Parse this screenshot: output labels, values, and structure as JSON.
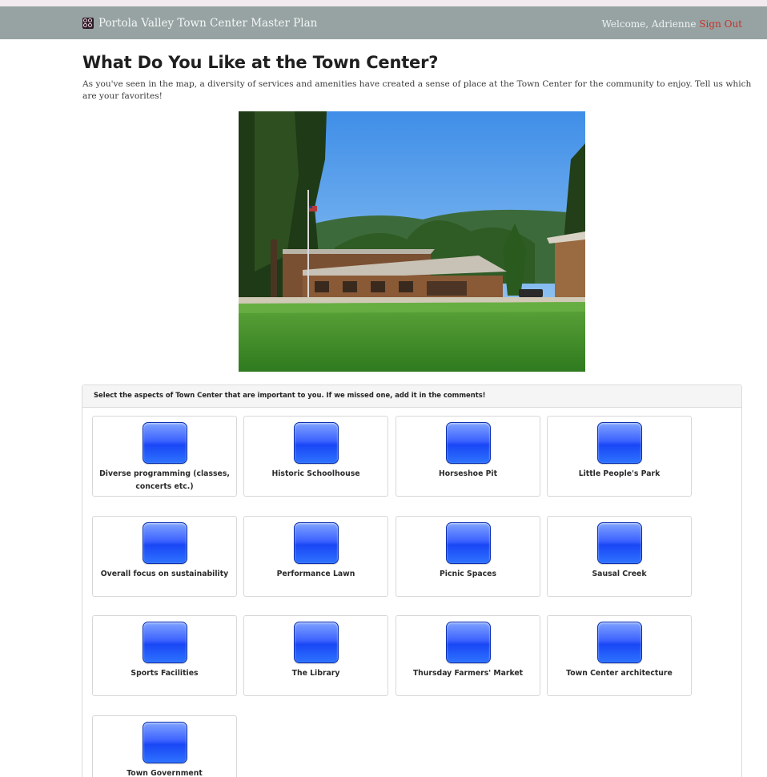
{
  "navbar": {
    "brand": "Portola Valley Town Center Master Plan",
    "welcome": "Welcome, Adrienne",
    "signout": "Sign Out"
  },
  "page": {
    "title": "What Do You Like at the Town Center?",
    "intro": "As you've seen in the map, a diversity of services and amenities have created a sense of place at the Town Center for the community to enjoy. Tell us which are your favorites!"
  },
  "panel": {
    "heading": "Select the aspects of Town Center that are important to you. If we missed one, add it in the comments!",
    "options": [
      {
        "label": "Diverse programming (classes, concerts etc.)"
      },
      {
        "label": "Historic Schoolhouse"
      },
      {
        "label": "Horseshoe Pit"
      },
      {
        "label": "Little People's Park"
      },
      {
        "label": "Overall focus on sustainability"
      },
      {
        "label": "Performance Lawn"
      },
      {
        "label": "Picnic Spaces"
      },
      {
        "label": "Sausal Creek"
      },
      {
        "label": "Sports Facilities"
      },
      {
        "label": "The Library"
      },
      {
        "label": "Thursday Farmers' Market"
      },
      {
        "label": "Town Center architecture"
      },
      {
        "label": "Town Government"
      }
    ]
  },
  "colors": {
    "navbar": "#96a3a2",
    "signout": "#c9302c",
    "option_button": "#2a5cff"
  }
}
